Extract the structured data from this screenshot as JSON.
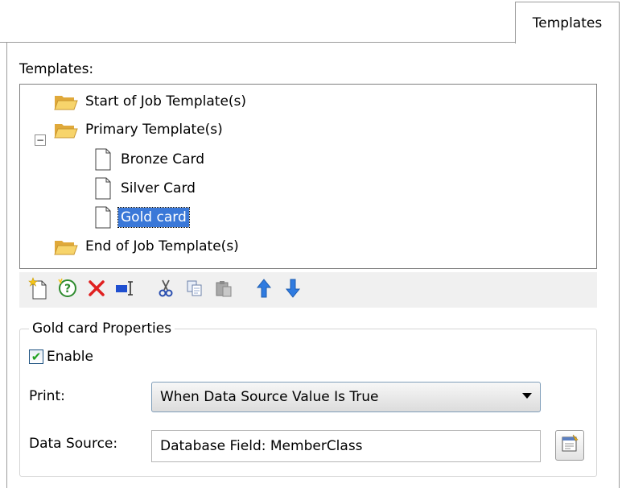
{
  "tab": {
    "label": "Templates"
  },
  "templates_label": "Templates:",
  "tree": {
    "start": "Start of Job Template(s)",
    "primary": "Primary Template(s)",
    "primary_expander": "−",
    "children": [
      "Bronze Card",
      "Silver Card",
      "Gold card"
    ],
    "selected_index": 2,
    "end": "End of Job Template(s)"
  },
  "toolbar": {
    "icons": [
      "new-template-icon",
      "help-icon",
      "delete-icon",
      "rename-icon",
      "cut-icon",
      "copy-icon",
      "paste-icon",
      "move-up-icon",
      "move-down-icon"
    ]
  },
  "properties": {
    "title": "Gold card Properties",
    "enable_label": "Enable",
    "enable_checked": true,
    "print_label": "Print:",
    "print_value": "When Data Source Value Is True",
    "data_source_label": "Data Source:",
    "data_source_value": "Database Field: MemberClass"
  },
  "colors": {
    "selection": "#3a78d8",
    "folder": "#f2c94c",
    "delete": "#e02020",
    "arrow_blue": "#2f7be0"
  }
}
